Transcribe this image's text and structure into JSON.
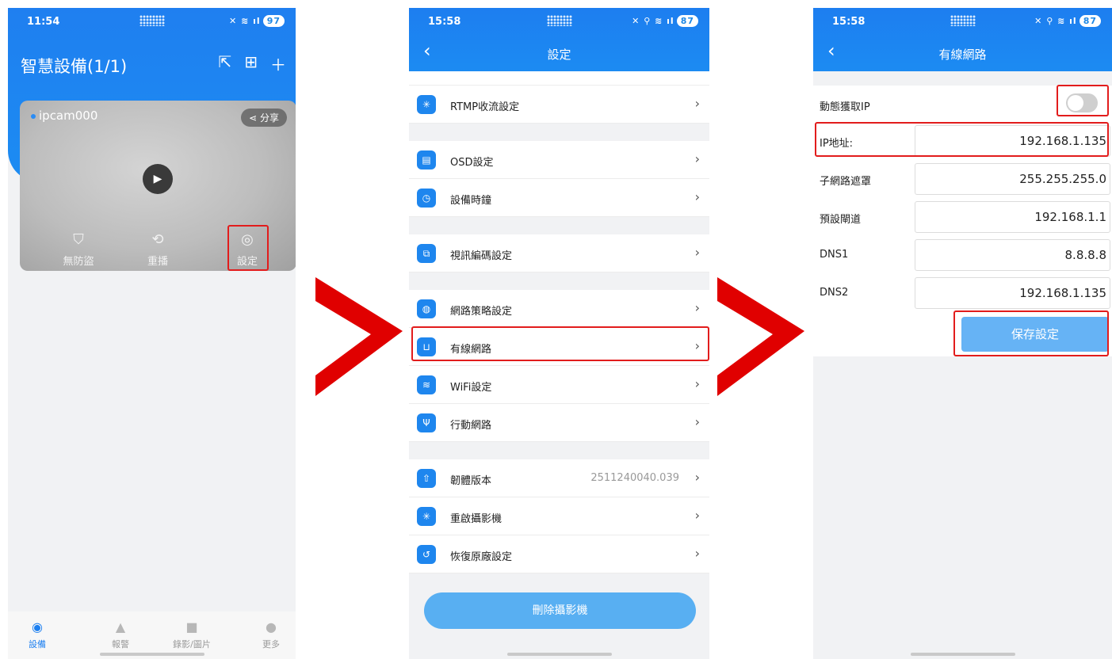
{
  "screen1": {
    "status": {
      "time": "11:54",
      "battery": "97"
    },
    "title": "智慧設備(1/1)",
    "camera": {
      "name": "ipcam000",
      "share_label": "分享"
    },
    "actions": [
      {
        "label": "無防盜",
        "icon": "shield-icon"
      },
      {
        "label": "重播",
        "icon": "replay-icon"
      },
      {
        "label": "設定",
        "icon": "settings-icon"
      }
    ],
    "tabs": [
      {
        "label": "設備",
        "icon": "camera-icon",
        "active": true
      },
      {
        "label": "報警",
        "icon": "bell-icon",
        "active": false
      },
      {
        "label": "錄影/圖片",
        "icon": "folder-icon",
        "active": false
      },
      {
        "label": "更多",
        "icon": "person-icon",
        "active": false
      }
    ]
  },
  "screen2": {
    "status": {
      "time": "15:58",
      "battery": "87"
    },
    "title": "設定",
    "items": [
      {
        "label": "RTMP收流設定",
        "icon": "rtmp-icon",
        "value": ""
      },
      {
        "label": "OSD設定",
        "icon": "osd-icon",
        "value": ""
      },
      {
        "label": "設備時鐘",
        "icon": "clock-icon",
        "value": ""
      },
      {
        "label": "視訊編碼設定",
        "icon": "code-icon",
        "value": ""
      },
      {
        "label": "網路策略設定",
        "icon": "globe-icon",
        "value": ""
      },
      {
        "label": "有線網路",
        "icon": "router-icon",
        "value": ""
      },
      {
        "label": "WiFi設定",
        "icon": "wifi-icon",
        "value": ""
      },
      {
        "label": "行動網路",
        "icon": "antenna-icon",
        "value": ""
      },
      {
        "label": "韌體版本",
        "icon": "upgrade-icon",
        "value": "2511240040.039"
      },
      {
        "label": "重啟攝影機",
        "icon": "restart-icon",
        "value": ""
      },
      {
        "label": "恢復原廠設定",
        "icon": "reset-icon",
        "value": ""
      }
    ],
    "delete_label": "刪除攝影機"
  },
  "screen3": {
    "status": {
      "time": "15:58",
      "battery": "87"
    },
    "title": "有線網路",
    "dhcp_label": "動態獲取IP",
    "dhcp_on": false,
    "fields": [
      {
        "label": "IP地址:",
        "value": "192.168.1.135"
      },
      {
        "label": "子網路遮罩",
        "value": "255.255.255.0"
      },
      {
        "label": "預設閘道",
        "value": "192.168.1.1"
      },
      {
        "label": "DNS1",
        "value": "8.8.8.8"
      },
      {
        "label": "DNS2",
        "value": "192.168.1.135"
      }
    ],
    "save_label": "保存設定"
  },
  "colors": {
    "primary": "#1c7ff0",
    "highlight": "#e21c1c",
    "arrow": "#e00000"
  }
}
